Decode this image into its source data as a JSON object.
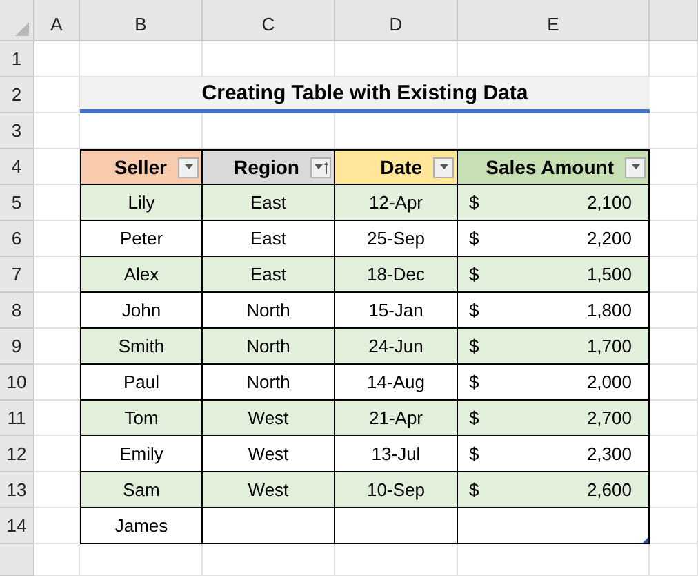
{
  "columns": [
    "A",
    "B",
    "C",
    "D",
    "E"
  ],
  "row_numbers": [
    "1",
    "2",
    "3",
    "4",
    "5",
    "6",
    "7",
    "8",
    "9",
    "10",
    "11",
    "12",
    "13",
    "14"
  ],
  "title": "Creating Table with Existing Data",
  "table": {
    "columns": [
      {
        "label": "Seller",
        "color": "#f8cbad",
        "sort_applied": false
      },
      {
        "label": "Region",
        "color": "#d9d9d9",
        "sort_applied": true
      },
      {
        "label": "Date",
        "color": "#ffe699",
        "sort_applied": false
      },
      {
        "label": "Sales Amount",
        "color": "#c6e0b4",
        "sort_applied": false
      }
    ],
    "rows": [
      {
        "seller": "Lily",
        "region": "East",
        "date": "12-Apr",
        "currency": "$",
        "amount": "2,100"
      },
      {
        "seller": "Peter",
        "region": "East",
        "date": "25-Sep",
        "currency": "$",
        "amount": "2,200"
      },
      {
        "seller": "Alex",
        "region": "East",
        "date": "18-Dec",
        "currency": "$",
        "amount": "1,500"
      },
      {
        "seller": "John",
        "region": "North",
        "date": "15-Jan",
        "currency": "$",
        "amount": "1,800"
      },
      {
        "seller": "Smith",
        "region": "North",
        "date": "24-Jun",
        "currency": "$",
        "amount": "1,700"
      },
      {
        "seller": "Paul",
        "region": "North",
        "date": "14-Aug",
        "currency": "$",
        "amount": "2,000"
      },
      {
        "seller": "Tom",
        "region": "West",
        "date": "21-Apr",
        "currency": "$",
        "amount": "2,700"
      },
      {
        "seller": "Emily",
        "region": "West",
        "date": "13-Jul",
        "currency": "$",
        "amount": "2,300"
      },
      {
        "seller": "Sam",
        "region": "West",
        "date": "10-Sep",
        "currency": "$",
        "amount": "2,600"
      },
      {
        "seller": "James"
      }
    ]
  }
}
